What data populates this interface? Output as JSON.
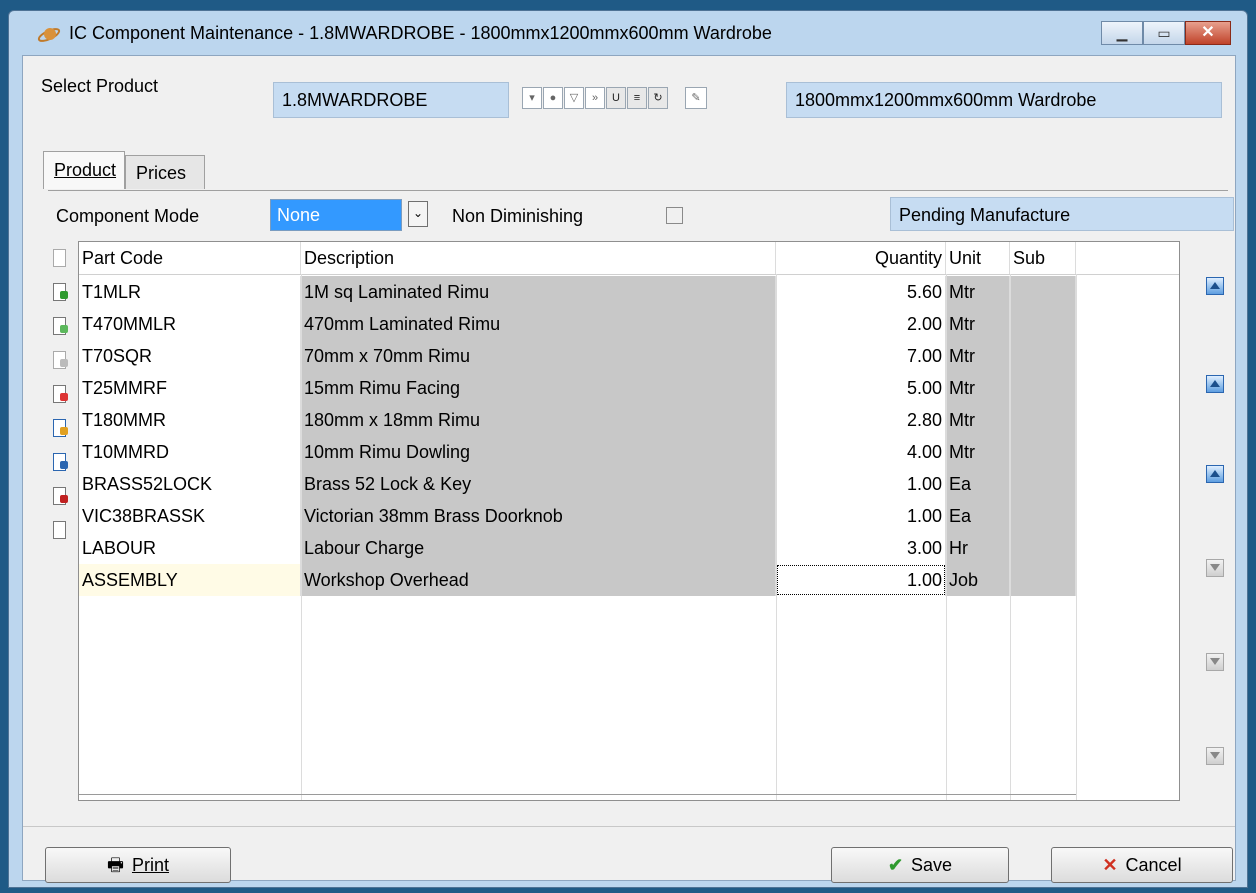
{
  "window": {
    "title": "IC Component Maintenance - 1.8MWARDROBE - 1800mmx1200mmx600mm Wardrobe",
    "icon": "planet-icon",
    "controls": {
      "minimize": "minimize-icon",
      "maximize": "maximize-icon",
      "close": "close-icon"
    }
  },
  "select_product": {
    "label": "Select Product",
    "code": "1.8MWARDROBE",
    "description": "1800mmx1200mmx600mm Wardrobe"
  },
  "tabs": [
    {
      "label": "Product",
      "active": true
    },
    {
      "label": "Prices",
      "active": false
    }
  ],
  "component_mode": {
    "label": "Component Mode",
    "value": "None"
  },
  "non_diminishing": {
    "label": "Non Diminishing",
    "checked": false
  },
  "status": "Pending Manufacture",
  "table": {
    "columns": [
      "Part Code",
      "Description",
      "Quantity",
      "Unit",
      "Sub"
    ],
    "rows": [
      {
        "part_code": "T1MLR",
        "description": "1M sq Laminated Rimu",
        "quantity": "5.60",
        "unit": "Mtr",
        "sub": ""
      },
      {
        "part_code": "T470MMLR",
        "description": "470mm Laminated Rimu",
        "quantity": "2.00",
        "unit": "Mtr",
        "sub": ""
      },
      {
        "part_code": "T70SQR",
        "description": "70mm x 70mm Rimu",
        "quantity": "7.00",
        "unit": "Mtr",
        "sub": ""
      },
      {
        "part_code": "T25MMRF",
        "description": "15mm Rimu Facing",
        "quantity": "5.00",
        "unit": "Mtr",
        "sub": ""
      },
      {
        "part_code": "T180MMR",
        "description": "180mm x 18mm Rimu",
        "quantity": "2.80",
        "unit": "Mtr",
        "sub": ""
      },
      {
        "part_code": "T10MMRD",
        "description": "10mm Rimu Dowling",
        "quantity": "4.00",
        "unit": "Mtr",
        "sub": ""
      },
      {
        "part_code": "BRASS52LOCK",
        "description": "Brass 52 Lock & Key",
        "quantity": "1.00",
        "unit": "Ea",
        "sub": ""
      },
      {
        "part_code": "VIC38BRASSK",
        "description": "Victorian 38mm Brass Doorknob",
        "quantity": "1.00",
        "unit": "Ea",
        "sub": ""
      },
      {
        "part_code": "LABOUR",
        "description": "Labour Charge",
        "quantity": "3.00",
        "unit": "Hr",
        "sub": ""
      },
      {
        "part_code": "ASSEMBLY",
        "description": "Workshop Overhead",
        "quantity": "1.00",
        "unit": "Job",
        "sub": ""
      }
    ]
  },
  "buttons": {
    "print": "Print",
    "save": "Save",
    "cancel": "Cancel"
  },
  "colors": {
    "selection_blue": "#3399ff",
    "field_blue": "#c6dcf2",
    "readonly_gray": "#c8c8c8",
    "selected_row_cell": "#fffbe6"
  }
}
